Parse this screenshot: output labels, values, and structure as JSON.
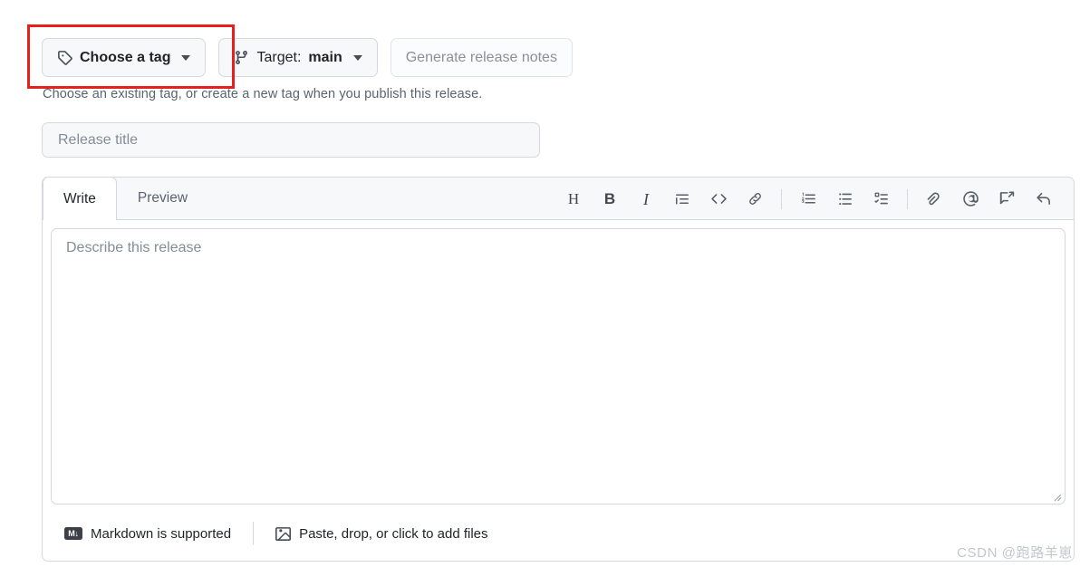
{
  "toolbar_top": {
    "choose_tag": {
      "label": "Choose a tag",
      "icon": "tag-icon",
      "caret": "chevron-down-icon"
    },
    "target": {
      "prefix": "Target:",
      "value": "main",
      "icon": "git-branch-icon",
      "caret": "chevron-down-icon"
    },
    "generate_notes": {
      "label": "Generate release notes",
      "disabled": true
    }
  },
  "helper_text": "Choose an existing tag, or create a new tag when you publish this release.",
  "release_title": {
    "placeholder": "Release title",
    "value": ""
  },
  "editor": {
    "tabs": [
      {
        "label": "Write",
        "active": true
      },
      {
        "label": "Preview",
        "active": false
      }
    ],
    "toolbar_groups": [
      [
        {
          "name": "heading-icon",
          "glyph": "H",
          "kind": "letter"
        },
        {
          "name": "bold-icon",
          "glyph": "B",
          "kind": "bold"
        },
        {
          "name": "italic-icon",
          "glyph": "I",
          "kind": "ital"
        },
        {
          "name": "quote-icon",
          "glyph": "",
          "kind": "svg"
        },
        {
          "name": "code-icon",
          "glyph": "<>",
          "kind": "code"
        },
        {
          "name": "link-icon",
          "glyph": "",
          "kind": "svg"
        }
      ],
      [
        {
          "name": "ordered-list-icon",
          "glyph": "",
          "kind": "svg"
        },
        {
          "name": "unordered-list-icon",
          "glyph": "",
          "kind": "svg"
        },
        {
          "name": "task-list-icon",
          "glyph": "",
          "kind": "svg"
        }
      ],
      [
        {
          "name": "attach-file-icon",
          "glyph": "",
          "kind": "svg"
        },
        {
          "name": "mention-icon",
          "glyph": "",
          "kind": "svg"
        },
        {
          "name": "saved-replies-icon",
          "glyph": "",
          "kind": "svg"
        },
        {
          "name": "reply-icon",
          "glyph": "",
          "kind": "svg"
        }
      ]
    ],
    "description": {
      "placeholder": "Describe this release",
      "value": ""
    },
    "footer": {
      "markdown": {
        "label": "Markdown is supported",
        "badge": "M"
      },
      "attach": {
        "label": "Paste, drop, or click to add files",
        "icon": "image-icon"
      }
    }
  },
  "annotation": {
    "color": "#e8201c"
  },
  "watermark": "CSDN @跑路羊崽"
}
